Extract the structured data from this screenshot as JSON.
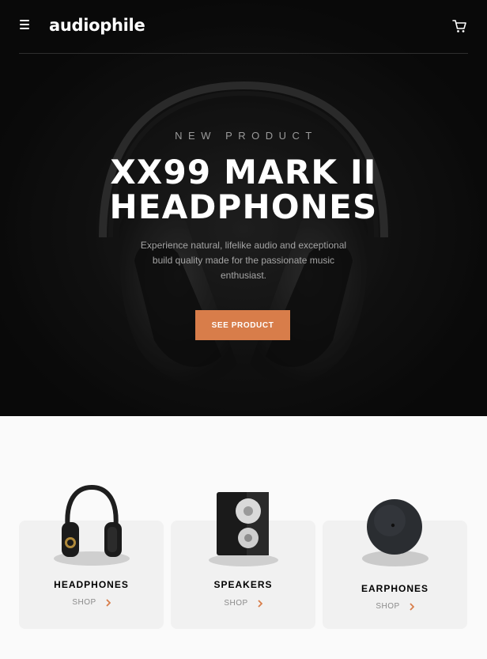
{
  "header": {
    "logo": "audiophile",
    "menu_icon": "hamburger-menu-icon",
    "cart_icon": "shopping-cart-icon"
  },
  "hero": {
    "overline": "NEW PRODUCT",
    "title_line1": "XX99 MARK II",
    "title_line2": "HEADPHONES",
    "description": "Experience natural, lifelike audio and exceptional build quality made for the passionate music enthusiast.",
    "cta_label": "SEE PRODUCT"
  },
  "categories": [
    {
      "name": "HEADPHONES",
      "shop_label": "SHOP"
    },
    {
      "name": "SPEAKERS",
      "shop_label": "SHOP"
    },
    {
      "name": "EARPHONES",
      "shop_label": "SHOP"
    }
  ],
  "colors": {
    "accent": "#d87d4a",
    "hero_bg": "#121212",
    "page_bg": "#fafafa",
    "card_bg": "#f1f1f1"
  }
}
